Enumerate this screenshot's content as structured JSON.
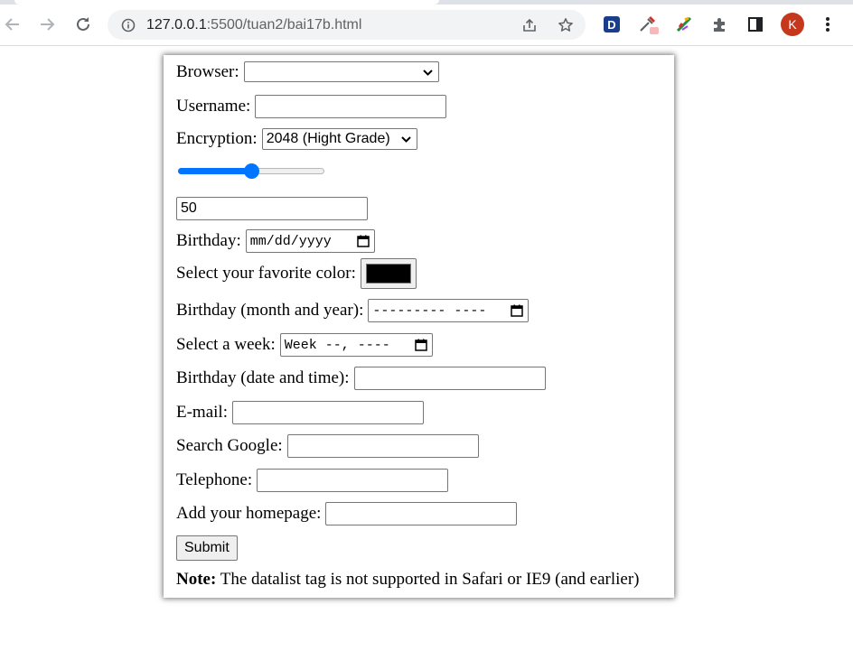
{
  "browser": {
    "url_host": "127.0.0.1",
    "url_rest": ":5500/tuan2/bai17b.html",
    "extension_d_label": "D",
    "profile_initial": "K",
    "colors": {
      "accent": "#0075ff",
      "avatar": "#c6381c",
      "ext_d": "#1a3d8c"
    },
    "icons": [
      "back-arrow-icon",
      "forward-arrow-icon",
      "reload-icon",
      "site-info-icon",
      "share-icon",
      "bookmark-star-icon",
      "extension-d-icon",
      "eyedropper-icon",
      "color-wheel-icon",
      "puzzle-icon",
      "side-panel-icon",
      "more-menu-icon"
    ]
  },
  "form": {
    "browser_label": "Browser:",
    "browser_value": "",
    "username_label": "Username:",
    "username_value": "",
    "encryption_label": "Encryption:",
    "encryption_value": "2048 (Hight Grade)",
    "range_percent": 50,
    "range_output": "50",
    "birthday_label": "Birthday:",
    "birthday_placeholder": "mm/dd/yyyy",
    "color_label": "Select your favorite color:",
    "color_value": "#000000",
    "month_label": "Birthday (month and year):",
    "month_placeholder": "--------- ----",
    "week_label": "Select a week:",
    "week_placeholder": "Week --, ----",
    "datetime_label": "Birthday (date and time):",
    "datetime_value": "",
    "email_label": "E-mail:",
    "email_value": "",
    "search_label": "Search Google:",
    "search_value": "",
    "telephone_label": "Telephone:",
    "telephone_value": "",
    "homepage_label": "Add your homepage:",
    "homepage_value": "",
    "submit_label": "Submit",
    "note_bold": "Note:",
    "note_text": " The datalist tag is not supported in Safari or IE9 (and earlier)"
  }
}
